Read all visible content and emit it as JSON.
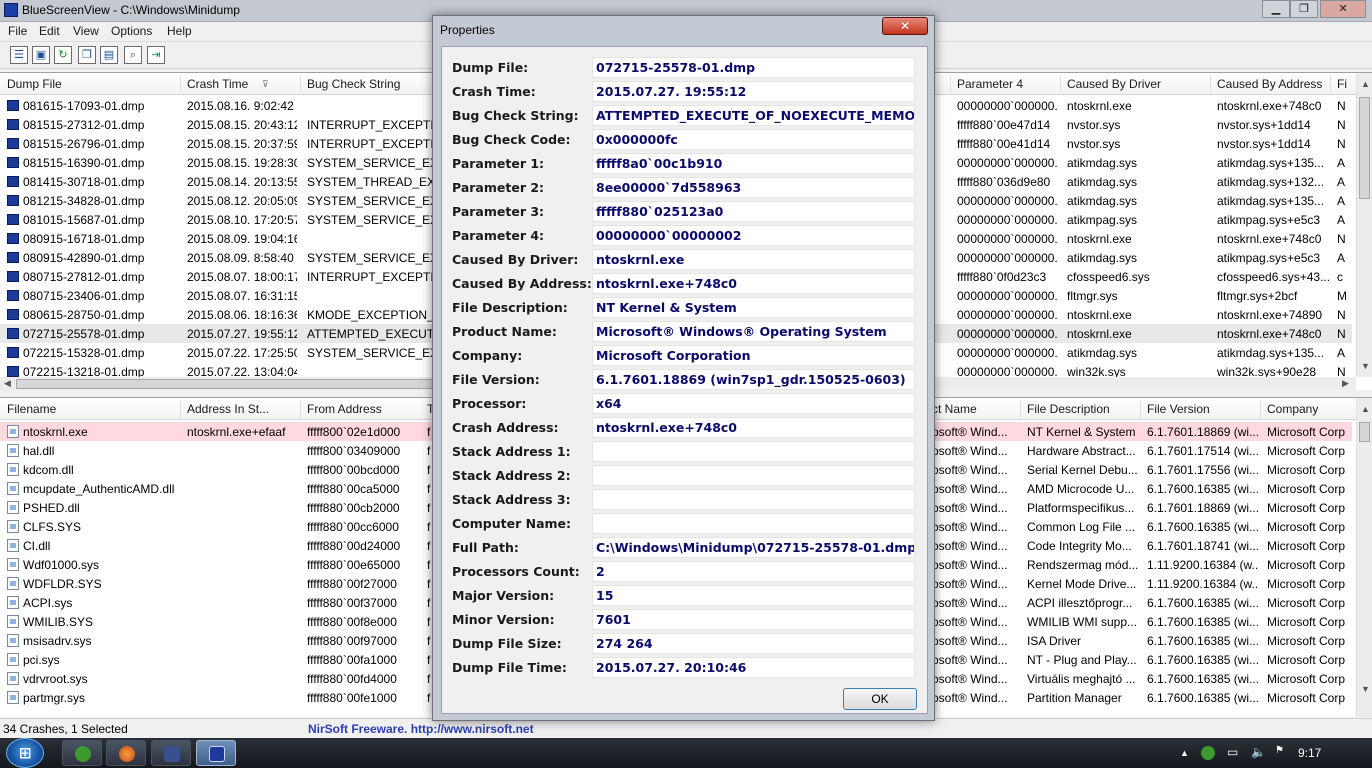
{
  "app": {
    "title": "BlueScreenView  -  C:\\Windows\\Minidump"
  },
  "caption_buttons": {
    "minimize": "▁",
    "maximize": "❐",
    "close": "✕"
  },
  "menu": [
    "File",
    "Edit",
    "View",
    "Options",
    "Help"
  ],
  "toolbar_icons": [
    "properties-icon",
    "save-icon",
    "refresh-icon",
    "copy-icon",
    "html-report-icon",
    "find-icon",
    "exit-icon"
  ],
  "upper_columns": [
    "Dump File",
    "Crash Time",
    "Bug Check String",
    "Parameter 4",
    "Caused By Driver",
    "Caused By Address",
    "Fi"
  ],
  "upper_rows": [
    {
      "file": "081615-17093-01.dmp",
      "time": "2015.08.16. 9:02:42",
      "bug": "",
      "p4": "00000000`000000...",
      "driver": "ntoskrnl.exe",
      "addr": "ntoskrnl.exe+748c0",
      "fi": "N"
    },
    {
      "file": "081515-27312-01.dmp",
      "time": "2015.08.15. 20:43:12",
      "bug": "INTERRUPT_EXCEPTION",
      "p4": "fffff880`00e47d14",
      "driver": "nvstor.sys",
      "addr": "nvstor.sys+1dd14",
      "fi": "N"
    },
    {
      "file": "081515-26796-01.dmp",
      "time": "2015.08.15. 20:37:59",
      "bug": "INTERRUPT_EXCEPTION",
      "p4": "fffff880`00e41d14",
      "driver": "nvstor.sys",
      "addr": "nvstor.sys+1dd14",
      "fi": "N"
    },
    {
      "file": "081515-16390-01.dmp",
      "time": "2015.08.15. 19:28:30",
      "bug": "SYSTEM_SERVICE_EXCE",
      "p4": "00000000`000000...",
      "driver": "atikmdag.sys",
      "addr": "atikmdag.sys+135...",
      "fi": "A"
    },
    {
      "file": "081415-30718-01.dmp",
      "time": "2015.08.14. 20:13:55",
      "bug": "SYSTEM_THREAD_EXCE",
      "p4": "fffff880`036d9e80",
      "driver": "atikmdag.sys",
      "addr": "atikmdag.sys+132...",
      "fi": "A"
    },
    {
      "file": "081215-34828-01.dmp",
      "time": "2015.08.12. 20:05:09",
      "bug": "SYSTEM_SERVICE_EXCE",
      "p4": "00000000`000000...",
      "driver": "atikmdag.sys",
      "addr": "atikmdag.sys+135...",
      "fi": "A"
    },
    {
      "file": "081015-15687-01.dmp",
      "time": "2015.08.10. 17:20:57",
      "bug": "SYSTEM_SERVICE_EXCE",
      "p4": "00000000`000000...",
      "driver": "atikmpag.sys",
      "addr": "atikmpag.sys+e5c3",
      "fi": "A"
    },
    {
      "file": "080915-16718-01.dmp",
      "time": "2015.08.09. 19:04:16",
      "bug": "",
      "p4": "00000000`000000...",
      "driver": "ntoskrnl.exe",
      "addr": "ntoskrnl.exe+748c0",
      "fi": "N"
    },
    {
      "file": "080915-42890-01.dmp",
      "time": "2015.08.09. 8:58:40",
      "bug": "SYSTEM_SERVICE_EXCE",
      "p4": "00000000`000000...",
      "driver": "atikmdag.sys",
      "addr": "atikmpag.sys+e5c3",
      "fi": "A"
    },
    {
      "file": "080715-27812-01.dmp",
      "time": "2015.08.07. 18:00:17",
      "bug": "INTERRUPT_EXCEPTION",
      "p4": "fffff880`0f0d23c3",
      "driver": "cfosspeed6.sys",
      "addr": "cfosspeed6.sys+43...",
      "fi": "c"
    },
    {
      "file": "080715-23406-01.dmp",
      "time": "2015.08.07. 16:31:15",
      "bug": "",
      "p4": "00000000`000000...",
      "driver": "fltmgr.sys",
      "addr": "fltmgr.sys+2bcf",
      "fi": "M"
    },
    {
      "file": "080615-28750-01.dmp",
      "time": "2015.08.06. 18:16:36",
      "bug": "KMODE_EXCEPTION_N",
      "p4": "00000000`000000...",
      "driver": "ntoskrnl.exe",
      "addr": "ntoskrnl.exe+74890",
      "fi": "N"
    },
    {
      "file": "072715-25578-01.dmp",
      "time": "2015.07.27. 19:55:12",
      "bug": "ATTEMPTED_EXECUTE_",
      "p4": "00000000`000000...",
      "driver": "ntoskrnl.exe",
      "addr": "ntoskrnl.exe+748c0",
      "fi": "N"
    },
    {
      "file": "072215-15328-01.dmp",
      "time": "2015.07.22. 17:25:50",
      "bug": "SYSTEM_SERVICE_EXCE",
      "p4": "00000000`000000...",
      "driver": "atikmdag.sys",
      "addr": "atikmdag.sys+135...",
      "fi": "A"
    },
    {
      "file": "072215-13218-01.dmp",
      "time": "2015.07.22. 13:04:04",
      "bug": "",
      "p4": "00000000`000000...",
      "driver": "win32k.sys",
      "addr": "win32k.sys+90e28",
      "fi": "N"
    }
  ],
  "lower_columns": [
    "Filename",
    "Address In St...",
    "From Address",
    "T",
    "ct Name",
    "File Description",
    "File Version",
    "Company"
  ],
  "lower_rows": [
    {
      "file": "ntoskrnl.exe",
      "addrst": "ntoskrnl.exe+efaaf",
      "from": "fffff800`02e1d000",
      "t": "f",
      "prod": "osoft® Wind...",
      "desc": "NT Kernel & System",
      "ver": "6.1.7601.18869 (wi...",
      "comp": "Microsoft Corp"
    },
    {
      "file": "hal.dll",
      "addrst": "",
      "from": "fffff800`03409000",
      "t": "f",
      "prod": "osoft® Wind...",
      "desc": "Hardware Abstract...",
      "ver": "6.1.7601.17514 (wi...",
      "comp": "Microsoft Corp"
    },
    {
      "file": "kdcom.dll",
      "addrst": "",
      "from": "fffff800`00bcd000",
      "t": "f",
      "prod": "osoft® Wind...",
      "desc": "Serial Kernel Debu...",
      "ver": "6.1.7601.17556 (wi...",
      "comp": "Microsoft Corp"
    },
    {
      "file": "mcupdate_AuthenticAMD.dll",
      "addrst": "",
      "from": "fffff880`00ca5000",
      "t": "f",
      "prod": "osoft® Wind...",
      "desc": "AMD Microcode U...",
      "ver": "6.1.7600.16385 (wi...",
      "comp": "Microsoft Corp"
    },
    {
      "file": "PSHED.dll",
      "addrst": "",
      "from": "fffff880`00cb2000",
      "t": "f",
      "prod": "osoft® Wind...",
      "desc": "Platformspecifikus...",
      "ver": "6.1.7601.18869 (wi...",
      "comp": "Microsoft Corp"
    },
    {
      "file": "CLFS.SYS",
      "addrst": "",
      "from": "fffff880`00cc6000",
      "t": "f",
      "prod": "osoft® Wind...",
      "desc": "Common Log File ...",
      "ver": "6.1.7600.16385 (wi...",
      "comp": "Microsoft Corp"
    },
    {
      "file": "CI.dll",
      "addrst": "",
      "from": "fffff880`00d24000",
      "t": "f",
      "prod": "osoft® Wind...",
      "desc": "Code Integrity Mo...",
      "ver": "6.1.7601.18741 (wi...",
      "comp": "Microsoft Corp"
    },
    {
      "file": "Wdf01000.sys",
      "addrst": "",
      "from": "fffff880`00e65000",
      "t": "f",
      "prod": "osoft® Wind...",
      "desc": "Rendszermag mód...",
      "ver": "1.11.9200.16384 (w...",
      "comp": "Microsoft Corp"
    },
    {
      "file": "WDFLDR.SYS",
      "addrst": "",
      "from": "fffff880`00f27000",
      "t": "f",
      "prod": "osoft® Wind...",
      "desc": "Kernel Mode Drive...",
      "ver": "1.11.9200.16384 (w...",
      "comp": "Microsoft Corp"
    },
    {
      "file": "ACPI.sys",
      "addrst": "",
      "from": "fffff880`00f37000",
      "t": "f",
      "prod": "osoft® Wind...",
      "desc": "ACPI illesztőprogr...",
      "ver": "6.1.7600.16385 (wi...",
      "comp": "Microsoft Corp"
    },
    {
      "file": "WMILIB.SYS",
      "addrst": "",
      "from": "fffff880`00f8e000",
      "t": "f",
      "prod": "osoft® Wind...",
      "desc": "WMILIB WMI supp...",
      "ver": "6.1.7600.16385 (wi...",
      "comp": "Microsoft Corp"
    },
    {
      "file": "msisadrv.sys",
      "addrst": "",
      "from": "fffff880`00f97000",
      "t": "f",
      "prod": "osoft® Wind...",
      "desc": "ISA Driver",
      "ver": "6.1.7600.16385 (wi...",
      "comp": "Microsoft Corp"
    },
    {
      "file": "pci.sys",
      "addrst": "",
      "from": "fffff880`00fa1000",
      "t": "f",
      "prod": "osoft® Wind...",
      "desc": "NT - Plug and Play...",
      "ver": "6.1.7600.16385 (wi...",
      "comp": "Microsoft Corp"
    },
    {
      "file": "vdrvroot.sys",
      "addrst": "",
      "from": "fffff880`00fd4000",
      "t": "f",
      "prod": "osoft® Wind...",
      "desc": "Virtuális meghajtó ...",
      "ver": "6.1.7600.16385 (wi...",
      "comp": "Microsoft Corp"
    },
    {
      "file": "partmgr.sys",
      "addrst": "",
      "from": "fffff880`00fe1000",
      "t": "f",
      "prod": "osoft® Wind...",
      "desc": "Partition Manager",
      "ver": "6.1.7600.16385 (wi...",
      "comp": "Microsoft Corp"
    }
  ],
  "status": {
    "count": "34 Crashes, 1 Selected",
    "freeware": "NirSoft Freeware.  http://www.nirsoft.net"
  },
  "dialog": {
    "title": "Properties",
    "close": "✕",
    "ok": "OK",
    "fields": [
      {
        "label": "Dump File:",
        "value": "072715-25578-01.dmp"
      },
      {
        "label": "Crash Time:",
        "value": "2015.07.27. 19:55:12"
      },
      {
        "label": "Bug Check String:",
        "value": "ATTEMPTED_EXECUTE_OF_NOEXECUTE_MEMO"
      },
      {
        "label": "Bug Check Code:",
        "value": "0x000000fc"
      },
      {
        "label": "Parameter 1:",
        "value": "fffff8a0`00c1b910"
      },
      {
        "label": "Parameter 2:",
        "value": "8ee00000`7d558963"
      },
      {
        "label": "Parameter 3:",
        "value": "fffff880`025123a0"
      },
      {
        "label": "Parameter 4:",
        "value": "00000000`00000002"
      },
      {
        "label": "Caused By Driver:",
        "value": "ntoskrnl.exe"
      },
      {
        "label": "Caused By Address:",
        "value": "ntoskrnl.exe+748c0"
      },
      {
        "label": "File Description:",
        "value": "NT Kernel & System"
      },
      {
        "label": "Product Name:",
        "value": "Microsoft® Windows® Operating System"
      },
      {
        "label": "Company:",
        "value": "Microsoft Corporation"
      },
      {
        "label": "File Version:",
        "value": "6.1.7601.18869 (win7sp1_gdr.150525-0603)"
      },
      {
        "label": "Processor:",
        "value": "x64"
      },
      {
        "label": "Crash Address:",
        "value": "ntoskrnl.exe+748c0"
      },
      {
        "label": "Stack Address 1:",
        "value": ""
      },
      {
        "label": "Stack Address 2:",
        "value": ""
      },
      {
        "label": "Stack Address 3:",
        "value": ""
      },
      {
        "label": "Computer Name:",
        "value": ""
      },
      {
        "label": "Full Path:",
        "value": "C:\\Windows\\Minidump\\072715-25578-01.dmp"
      },
      {
        "label": "Processors Count:",
        "value": "2"
      },
      {
        "label": "Major Version:",
        "value": "15"
      },
      {
        "label": "Minor Version:",
        "value": "7601"
      },
      {
        "label": "Dump File Size:",
        "value": "274 264"
      },
      {
        "label": "Dump File Time:",
        "value": "2015.07.27. 20:10:46"
      }
    ]
  },
  "taskbar": {
    "start_glyph": "⊞",
    "apps": [
      "utorrent-icon",
      "firefox-icon",
      "floppy-save-icon",
      "bluescreenview-icon"
    ],
    "clock": "9:17"
  }
}
